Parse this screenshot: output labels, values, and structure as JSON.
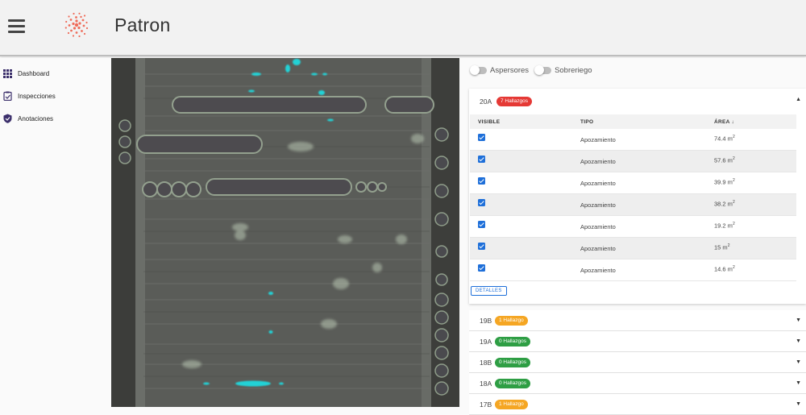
{
  "app": {
    "title": "Patron",
    "brand_color": "#ef6c5a"
  },
  "sidebar": {
    "items": [
      {
        "label": "Dashboard",
        "icon": "grid-icon"
      },
      {
        "label": "Inspecciones",
        "icon": "clipboard-check-icon"
      },
      {
        "label": "Anotaciones",
        "icon": "shield-check-icon"
      }
    ]
  },
  "toggles": [
    {
      "label": "Aspersores",
      "on": false
    },
    {
      "label": "Sobreriego",
      "on": false
    }
  ],
  "expanded_sector": {
    "code": "20A",
    "badge": "7 Hallazgos",
    "badge_color": "#e53935",
    "columns": {
      "visible": "VISIBLE",
      "tipo": "TIPO",
      "area": "ÁREA ↓"
    },
    "rows": [
      {
        "visible": true,
        "tipo": "Apozamiento",
        "area": "74.4 m",
        "unit_sup": "2"
      },
      {
        "visible": true,
        "tipo": "Apozamiento",
        "area": "57.6 m",
        "unit_sup": "2"
      },
      {
        "visible": true,
        "tipo": "Apozamiento",
        "area": "39.9 m",
        "unit_sup": "2"
      },
      {
        "visible": true,
        "tipo": "Apozamiento",
        "area": "38.2 m",
        "unit_sup": "2"
      },
      {
        "visible": true,
        "tipo": "Apozamiento",
        "area": "19.2 m",
        "unit_sup": "2"
      },
      {
        "visible": true,
        "tipo": "Apozamiento",
        "area": "15 m",
        "unit_sup": "2"
      },
      {
        "visible": true,
        "tipo": "Apozamiento",
        "area": "14.6 m",
        "unit_sup": "2"
      }
    ],
    "details_label": "DETALLES"
  },
  "sectors": [
    {
      "code": "19B",
      "badge": "1 Hallazgo",
      "color": "orange"
    },
    {
      "code": "19A",
      "badge": "0 Hallazgos",
      "color": "green"
    },
    {
      "code": "18B",
      "badge": "0 Hallazgos",
      "color": "green"
    },
    {
      "code": "18A",
      "badge": "0 Hallazgos",
      "color": "green"
    },
    {
      "code": "17B",
      "badge": "1 Hallazgo",
      "color": "orange"
    }
  ]
}
